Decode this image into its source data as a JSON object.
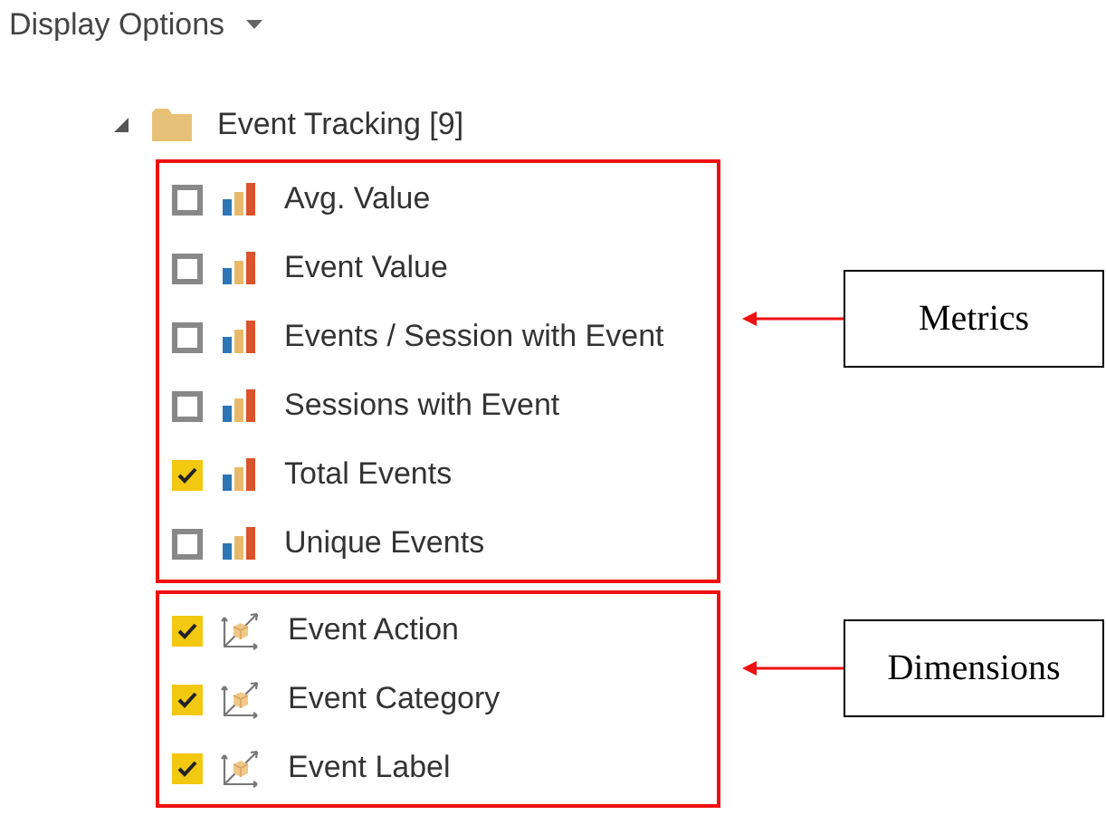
{
  "header": {
    "title": "Display Options"
  },
  "tree": {
    "label": "Event Tracking [9]",
    "expanded": true,
    "groups": [
      {
        "callout": "Metrics",
        "items": [
          {
            "label": "Avg. Value",
            "checked": false,
            "kind": "metric"
          },
          {
            "label": "Event Value",
            "checked": false,
            "kind": "metric"
          },
          {
            "label": "Events / Session with Event",
            "checked": false,
            "kind": "metric"
          },
          {
            "label": "Sessions with Event",
            "checked": false,
            "kind": "metric"
          },
          {
            "label": "Total Events",
            "checked": true,
            "kind": "metric"
          },
          {
            "label": "Unique Events",
            "checked": false,
            "kind": "metric"
          }
        ]
      },
      {
        "callout": "Dimensions",
        "items": [
          {
            "label": "Event Action",
            "checked": true,
            "kind": "dimension"
          },
          {
            "label": "Event Category",
            "checked": true,
            "kind": "dimension"
          },
          {
            "label": "Event Label",
            "checked": true,
            "kind": "dimension"
          }
        ]
      }
    ]
  }
}
